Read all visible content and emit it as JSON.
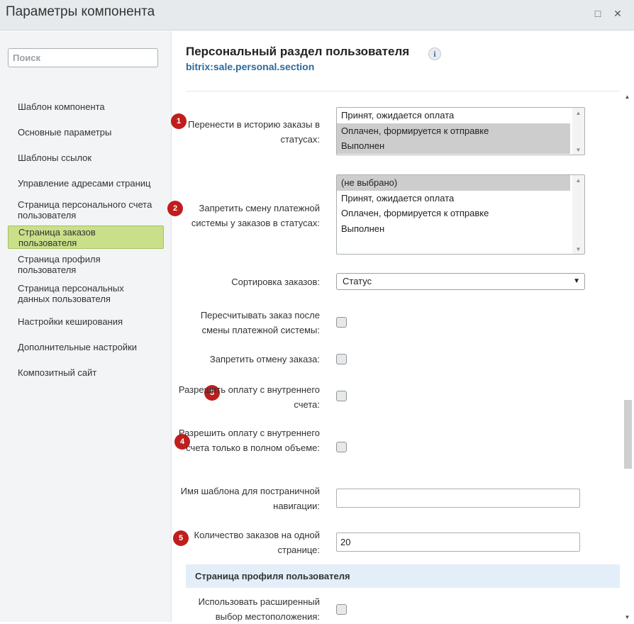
{
  "window": {
    "title": "Параметры компонента",
    "maximize_icon": "□",
    "close_icon": "✕"
  },
  "sidebar": {
    "search_placeholder": "Поиск",
    "items": [
      {
        "label": "Шаблон компонента"
      },
      {
        "label": "Основные параметры"
      },
      {
        "label": "Шаблоны ссылок"
      },
      {
        "label": "Управление адресами страниц"
      },
      {
        "label": "Страница персонального счета пользователя"
      },
      {
        "label": "Страница заказов пользователя",
        "active": true
      },
      {
        "label": "Страница профиля пользователя"
      },
      {
        "label": "Страница персональных данных пользователя"
      },
      {
        "label": "Настройки кеширования"
      },
      {
        "label": "Дополнительные настройки"
      },
      {
        "label": "Композитный сайт"
      }
    ]
  },
  "header": {
    "title": "Персональный раздел пользователя",
    "code": "bitrix:sale.personal.section",
    "info_icon": "i"
  },
  "fields": {
    "history_statuses": {
      "badge": "1",
      "label": "Перенести в историю заказы в статусах:",
      "options": [
        "Принят, ожидается оплата",
        "Оплачен, формируется к отправке",
        "Выполнен"
      ],
      "selected": [
        false,
        true,
        true
      ]
    },
    "forbid_payment_change": {
      "badge": "2",
      "label": "Запретить смену платежной системы у заказов в статусах:",
      "options": [
        "(не выбрано)",
        "Принят, ожидается оплата",
        "Оплачен, формируется к отправке",
        "Выполнен"
      ],
      "selected": [
        true,
        false,
        false,
        false
      ]
    },
    "sort_orders": {
      "label": "Сортировка заказов:",
      "value": "Статус"
    },
    "recalc_order": {
      "label": "Пересчитывать заказ после смены платежной системы:",
      "checked": false
    },
    "forbid_cancel": {
      "label": "Запретить отмену заказа:",
      "checked": false
    },
    "allow_inner_pay": {
      "badge": "3",
      "label": "Разрешить оплату с внутреннего счета:",
      "checked": false
    },
    "allow_inner_pay_full": {
      "badge": "4",
      "label": "Разрешить оплату с внутреннего счета только в полном объеме:",
      "checked": false
    },
    "nav_template": {
      "label": "Имя шаблона для постраничной навигации:",
      "value": ""
    },
    "orders_per_page": {
      "badge": "5",
      "label": "Количество заказов на одной странице:",
      "value": "20"
    }
  },
  "section": {
    "title": "Страница профиля пользователя"
  },
  "fields_profile": {
    "extended_location": {
      "label": "Использовать расширенный выбор местоположения:",
      "checked": false
    }
  },
  "colors": {
    "active_nav": "#c9df8a",
    "badge": "#c01d1d",
    "code_link": "#2b6aa0",
    "section_bg": "#e3eef8"
  }
}
